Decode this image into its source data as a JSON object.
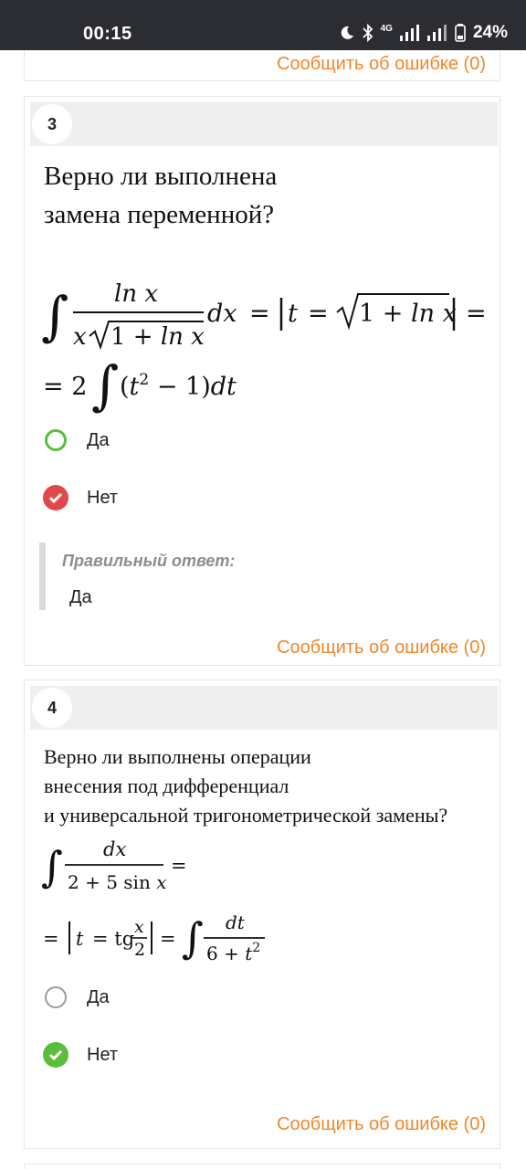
{
  "status_bar": {
    "time": "00:15",
    "network": "4G",
    "battery": "24%",
    "icons": [
      "moon-icon",
      "bluetooth-icon",
      "signal-icon",
      "signal-icon",
      "battery-icon"
    ]
  },
  "report_label": "Сообщить об ошибке (0)",
  "questions": [
    {
      "number": "3",
      "text_line1": "Верно ли выполнена",
      "text_line2": "замена переменной?",
      "options": [
        {
          "label": "Да",
          "state": "unchecked-correct"
        },
        {
          "label": "Нет",
          "state": "selected-wrong"
        }
      ],
      "correct_title": "Правильный ответ:",
      "correct_value": "Да"
    },
    {
      "number": "4",
      "text_line1": "Верно ли выполнены операции",
      "text_line2": "внесения под дифференциал",
      "text_line3": "и универсальной тригонометрической замены?",
      "options": [
        {
          "label": "Да",
          "state": "unchecked"
        },
        {
          "label": "Нет",
          "state": "selected-correct"
        }
      ]
    }
  ],
  "colors": {
    "accent_orange": "#f0862a",
    "correct_green": "#5bbd3c",
    "wrong_red": "#e0494c"
  }
}
